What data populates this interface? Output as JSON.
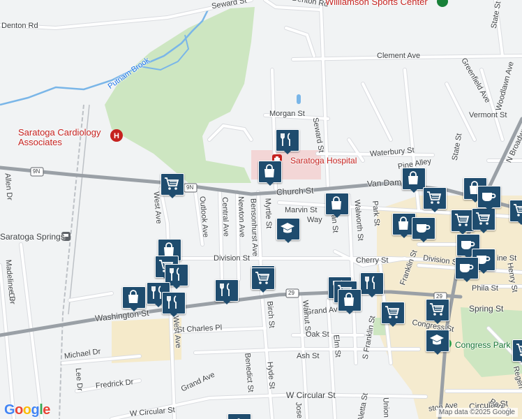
{
  "map": {
    "attribution": "Map data ©2025 Google",
    "logo_letters": [
      "G",
      "o",
      "o",
      "g",
      "l",
      "e"
    ],
    "logo_colors": [
      "#4285f4",
      "#ea4335",
      "#fbbc05",
      "#4285f4",
      "#34a853",
      "#ea4335"
    ],
    "colors": {
      "background": "#f1f3f4",
      "road": "#ffffff",
      "road_stroke": "#dadce0",
      "highway": "#9aa0a6",
      "park": "#cde6c1",
      "water": "#7ab6e8",
      "commercial": "#f6e7bf",
      "pin": "#1f4c6e",
      "hospital": "#f3d6d6"
    }
  },
  "labels": {
    "denton_rd_left": "Denton Rd",
    "denton_rd_top": "Denton Rd",
    "seward_st_top": "Seward St",
    "sports_center": "Williamson Sports Center",
    "state_st_top": "State St",
    "clement_ave": "Clement Ave",
    "greenfield_ave": "Greenfield Ave",
    "woodlawn_ave": "Woodlawn Ave",
    "putnam_brook": "Putnam Brook",
    "vermont_st": "Vermont St",
    "morgan_st": "Morgan St",
    "seward_st": "Seward St",
    "n_broadway": "N Broadway",
    "state_st": "State St",
    "cardiology": "Saratoga Cardiology Associates",
    "waterbury_st": "Waterbury St",
    "saratoga_hospital": "Saratoga Hospital",
    "pine_alley": "Pine Alley",
    "route_9n": "9N",
    "route_9n_small": "9N",
    "church_st": "Church St",
    "van_dam": "Van Dam",
    "west_ave": "West Ave",
    "outlook_ave": "Outlook Ave",
    "central_ave": "Central Ave",
    "newton_ave": "Newton Ave",
    "bensonhurst_ave": "Bensonhurst Ave",
    "myrtle_st": "Myrtle St",
    "marvin_st": "Marvin St",
    "way": "Way",
    "walworth_st": "Walworth St",
    "park_st": "Park St",
    "an_st": "an St",
    "allen_dr": "Allen Dr",
    "saratoga_springs": "Saratoga Springs",
    "division_st": "Division St",
    "division_st_east": "Division St",
    "cherry_st": "Cherry St",
    "franklin_st": "Franklin St",
    "madeline_dr": "Madeline Dr",
    "e_dr": "e Dr",
    "route_29": "29",
    "route_29_east": "29",
    "washington_st": "Washington St",
    "grand_ave": "Grand Ave",
    "spring_st": "Spring St",
    "phila_st": "Phila St",
    "henry_st": "Henry St",
    "ine_st": "ine St",
    "birch_st": "Birch St",
    "walnut_st": "Walnut St",
    "oak_st": "Oak St",
    "elm_st": "Elm St",
    "s_franklin_st": "S Franklin St",
    "congress_st": "Congress St",
    "congress_park": "Congress Park",
    "st_charles_pl": "St Charles Pl",
    "michael_dr": "Michael Dr",
    "lee_dr": "Lee Dr",
    "fredrick_dr": "Fredrick Dr",
    "grand_ave_sw": "Grand Ave",
    "benedict_st": "Benedict St",
    "hyde_st": "Hyde St",
    "ash_st": "Ash St",
    "w_circular_st": "W Circular St",
    "w_circular_st_sw": "W Circular St",
    "jose": "Jose",
    "aletta_st": "Aletta St",
    "union": "Union",
    "circular_st": "Circular St",
    "ston_ave": "ston Ave",
    "park_pl": "Park Pl",
    "regen": "Regen",
    "west_ave_south": "West Ave"
  },
  "pois": [
    {
      "name": "restaurant-marker",
      "icon": "restaurant"
    },
    {
      "name": "shopping-marker",
      "icon": "shopping"
    },
    {
      "name": "grocery-marker",
      "icon": "grocery"
    },
    {
      "name": "school-marker",
      "icon": "school"
    },
    {
      "name": "cafe-marker",
      "icon": "cafe"
    },
    {
      "name": "hospital-marker",
      "icon": "hospital"
    }
  ]
}
